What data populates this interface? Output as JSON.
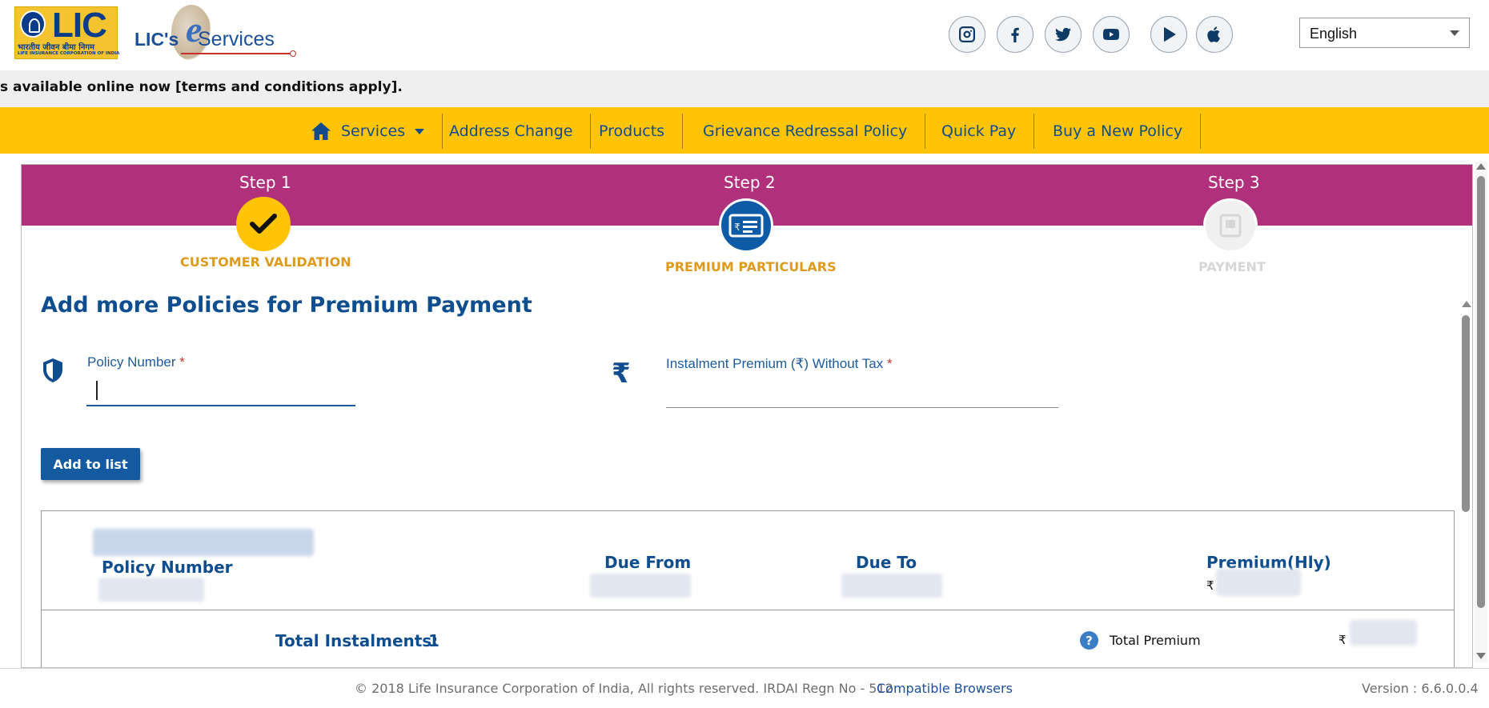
{
  "header": {
    "logo_text": "LIC",
    "logo_sub1": "भारतीय जीवन बीमा निगम",
    "logo_sub2": "LIFE INSURANCE CORPORATION OF INDIA",
    "eservices_prefix": "LIC's",
    "eservices_e": "e",
    "eservices_word": "Services",
    "social": [
      "instagram-icon",
      "facebook-icon",
      "twitter-icon",
      "youtube-icon",
      "google-play-icon",
      "apple-icon"
    ],
    "language": "English"
  },
  "marquee": {
    "text": "s available online now [terms and conditions apply]."
  },
  "nav": {
    "items": [
      {
        "label": "Services"
      },
      {
        "label": "Address Change"
      },
      {
        "label": "Products"
      },
      {
        "label": "Grievance Redressal Policy"
      },
      {
        "label": "Quick Pay"
      },
      {
        "label": "Buy a New Policy"
      }
    ]
  },
  "steps": [
    {
      "label": "Step 1",
      "name": "CUSTOMER VALIDATION",
      "state": "done"
    },
    {
      "label": "Step 2",
      "name": "PREMIUM PARTICULARS",
      "state": "active"
    },
    {
      "label": "Step 3",
      "name": "PAYMENT",
      "state": "pending"
    }
  ],
  "form": {
    "title": "Add more Policies for Premium Payment",
    "policy_label": "Policy Number",
    "premium_label": "Instalment Premium (₹) Without Tax",
    "required_mark": "*",
    "policy_value": "",
    "premium_value": "",
    "add_button": "Add to list"
  },
  "table": {
    "columns": [
      "Policy Number",
      "Due From",
      "Due To",
      "Premium(Hly)"
    ],
    "rupee": "₹",
    "total_instalments_label": "Total Instalments:",
    "total_instalments_value": "1",
    "help_symbol": "?",
    "total_premium_label": "Total Premium"
  },
  "footer": {
    "copyright": "© 2018 Life Insurance Corporation of India, All rights reserved. IRDAI Regn No - 512",
    "compatible": "Compatible Browsers",
    "version": "Version : 6.6.0.0.4"
  },
  "colors": {
    "nav_yellow": "#ffc406",
    "step_band": "#b0307b",
    "brand_blue": "#0e4d8e",
    "step_gold": "#df9a1c"
  }
}
